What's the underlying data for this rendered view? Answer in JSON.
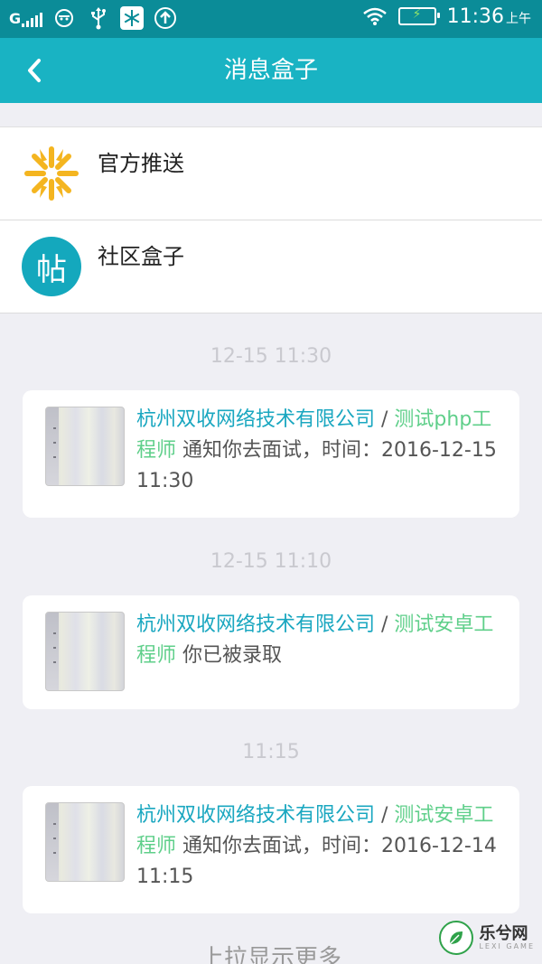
{
  "status_bar": {
    "signal_label": "G",
    "time": "11:36",
    "ampm": "上午",
    "icons": [
      "signal-icon",
      "face-icon",
      "usb-icon",
      "snowflake-app-icon",
      "upload-icon",
      "wifi-icon",
      "battery-icon"
    ]
  },
  "nav": {
    "title": "消息盒子",
    "back_icon": "chevron-left-icon"
  },
  "entries": [
    {
      "label": "官方推送",
      "icon": "starburst-logo-icon"
    },
    {
      "label": "社区盒子",
      "icon": "tie-badge-icon",
      "badge_char": "帖"
    }
  ],
  "messages": [
    {
      "time": "12-15 11:30",
      "company": "杭州双收网络技术有限公司",
      "separator": " / ",
      "job": "测试php工程师",
      "body": " 通知你去面试，时间：2016-12-15 11:30"
    },
    {
      "time": "12-15 11:10",
      "company": "杭州双收网络技术有限公司",
      "separator": " / ",
      "job": "测试安卓工程师",
      "body": " 你已被录取"
    },
    {
      "time": "11:15",
      "company": "杭州双收网络技术有限公司",
      "separator": " / ",
      "job": "测试安卓工程师",
      "body": " 通知你去面试，时间：2016-12-14 11:15"
    }
  ],
  "bottom_hint": "上拉显示更多",
  "watermark": {
    "text": "乐兮网",
    "sub": "LEXI GAME"
  },
  "colors": {
    "status_bar": "#0b8c98",
    "nav_bar": "#19b3c3",
    "company_link": "#1aa7c0",
    "job_link": "#5fcf8a",
    "background": "#efeff4"
  }
}
